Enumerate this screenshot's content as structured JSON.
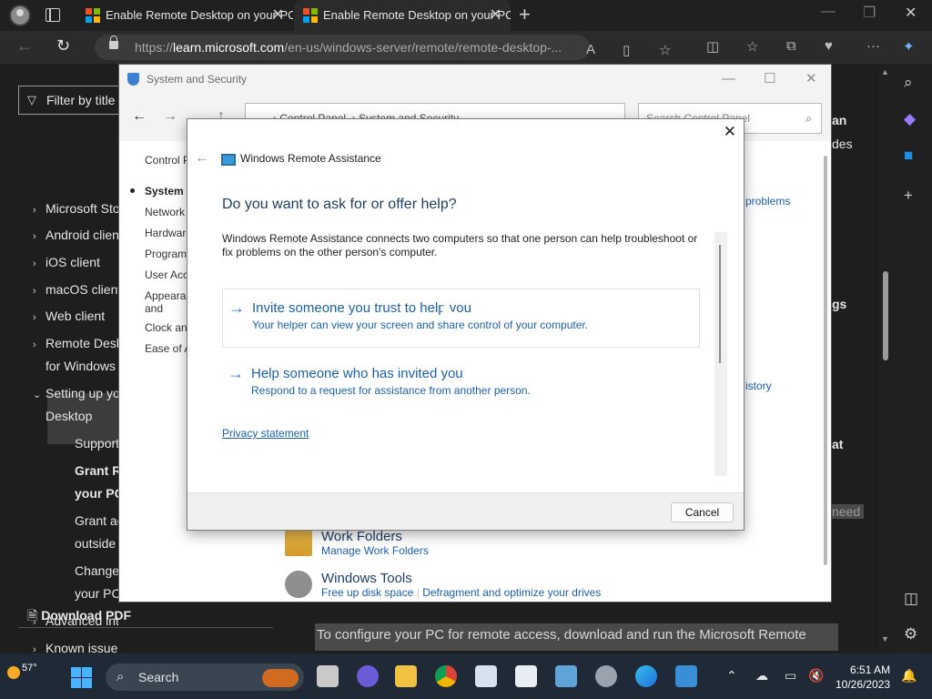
{
  "browser": {
    "tabs": [
      {
        "title": "Enable Remote Desktop on your PC"
      },
      {
        "title": "Enable Remote Desktop on your PC"
      }
    ],
    "url_prefix": "https://",
    "url_domain": "learn.microsoft.com",
    "url_path": "/en-us/windows-server/remote/remote-desktop-..."
  },
  "webpage": {
    "filter_placeholder": "Filter by title",
    "toc": [
      {
        "label": "Microsoft Sto",
        "chevron": "›"
      },
      {
        "label": "Android client",
        "chevron": "›"
      },
      {
        "label": "iOS client",
        "chevron": "›"
      },
      {
        "label": "macOS client",
        "chevron": "›"
      },
      {
        "label": "Web client",
        "chevron": "›"
      },
      {
        "label": "Remote Desk",
        "chevron": "›"
      },
      {
        "label": "for Windows",
        "chevron": ""
      },
      {
        "label": "Setting up yo",
        "chevron": "⌄"
      },
      {
        "label": "Desktop",
        "chevron": ""
      },
      {
        "label": "Supported",
        "chevron": ""
      },
      {
        "label": "Grant Rem",
        "chevron": ""
      },
      {
        "label": "your PC",
        "chevron": ""
      },
      {
        "label": "Grant acce",
        "chevron": ""
      },
      {
        "label": "outside yo",
        "chevron": ""
      },
      {
        "label": "Change th",
        "chevron": ""
      },
      {
        "label": "your PC",
        "chevron": ""
      },
      {
        "label": "Advanced int",
        "chevron": "›"
      },
      {
        "label": "Known issue",
        "chevron": "›"
      }
    ],
    "download_pdf": "Download PDF",
    "right_fragments": [
      "an",
      "des",
      "gs",
      "at",
      "need"
    ],
    "bottom_text": "To configure your PC for remote access, download and run the Microsoft Remote"
  },
  "control_panel": {
    "window_title": "System and Security",
    "breadcrumb_root": "Control Panel",
    "breadcrumb_current": "System and Security",
    "search_placeholder": "Search Control Panel",
    "left_nav": [
      "Control Panel Home",
      "System and Security",
      "Network and Internet",
      "Hardware and Sound",
      "Programs",
      "User Accounts",
      "Appearance and Personalization",
      "Clock and Region",
      "Ease of Access"
    ],
    "right_links": [
      "problems",
      "istory"
    ],
    "work_folders_title": "Work Folders",
    "work_folders_link": "Manage Work Folders",
    "windows_tools_title": "Windows Tools",
    "windows_tools_link1": "Free up disk space",
    "windows_tools_link2": "Defragment and optimize your drives"
  },
  "dialog": {
    "app_title": "Windows Remote Assistance",
    "question": "Do you want to ask for or offer help?",
    "description": "Windows Remote Assistance connects two computers so that one person can help troubleshoot or fix problems on the other person's computer.",
    "option_invite_title": "Invite someone you trust to help you",
    "option_invite_sub": "Your helper can view your screen and share control of your computer.",
    "option_help_title": "Help someone who has invited you",
    "option_help_sub": "Respond to a request for assistance from another person.",
    "privacy": "Privacy statement",
    "cancel": "Cancel"
  },
  "taskbar": {
    "temperature": "57°",
    "search": "Search",
    "time": "6:51 AM",
    "date": "10/26/2023"
  }
}
